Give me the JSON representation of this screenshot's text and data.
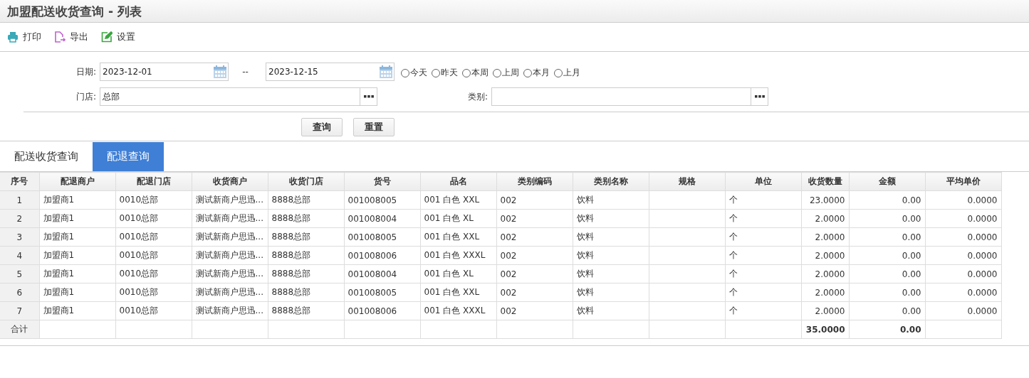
{
  "window": {
    "title": "加盟配送收货查询 - 列表"
  },
  "toolbar": [
    {
      "label": "打印"
    },
    {
      "label": "导出"
    },
    {
      "label": "设置"
    }
  ],
  "filters": {
    "date": {
      "label": "日期:",
      "from": "2023-12-01",
      "separator": "--",
      "to": "2023-12-15"
    },
    "quick_ranges": [
      {
        "label": "今天",
        "selected": false
      },
      {
        "label": "昨天",
        "selected": false
      },
      {
        "label": "本周",
        "selected": false
      },
      {
        "label": "上周",
        "selected": false
      },
      {
        "label": "本月",
        "selected": false
      },
      {
        "label": "上月",
        "selected": false
      }
    ],
    "store": {
      "label": "门店:",
      "value": "总部"
    },
    "category": {
      "label": "类别:"
    }
  },
  "buttons": [
    "查询",
    "重置"
  ],
  "tabs": [
    {
      "label": "配送收货查询",
      "selected": false
    },
    {
      "label": "配退查询",
      "selected": true
    }
  ],
  "table": {
    "columns": [
      {
        "label": "序号",
        "kind": "index"
      },
      {
        "label": "配退商户",
        "kind": "text"
      },
      {
        "label": "配退门店",
        "kind": "text"
      },
      {
        "label": "收货商户",
        "kind": "text"
      },
      {
        "label": "收货门店",
        "kind": "text"
      },
      {
        "label": "货号",
        "kind": "text"
      },
      {
        "label": "品名",
        "kind": "text"
      },
      {
        "label": "类别编码",
        "kind": "text"
      },
      {
        "label": "类别名称",
        "kind": "text"
      },
      {
        "label": "规格",
        "kind": "text"
      },
      {
        "label": "单位",
        "kind": "text"
      },
      {
        "label": "收货数量",
        "kind": "number",
        "total": "35.0000"
      },
      {
        "label": "金额",
        "kind": "number",
        "total": "0.00"
      },
      {
        "label": "平均单价",
        "kind": "number"
      }
    ],
    "rows": [
      [
        "1",
        "加盟商1",
        "0010总部",
        "测试新商户思迅...",
        "8888总部",
        "001008005",
        "001 白色 XXL",
        "002",
        "饮料",
        "",
        "个",
        "23.0000",
        "0.00",
        "0.0000"
      ],
      [
        "2",
        "加盟商1",
        "0010总部",
        "测试新商户思迅...",
        "8888总部",
        "001008004",
        "001 白色 XL",
        "002",
        "饮料",
        "",
        "个",
        "2.0000",
        "0.00",
        "0.0000"
      ],
      [
        "3",
        "加盟商1",
        "0010总部",
        "测试新商户思迅...",
        "8888总部",
        "001008005",
        "001 白色 XXL",
        "002",
        "饮料",
        "",
        "个",
        "2.0000",
        "0.00",
        "0.0000"
      ],
      [
        "4",
        "加盟商1",
        "0010总部",
        "测试新商户思迅...",
        "8888总部",
        "001008006",
        "001 白色 XXXL",
        "002",
        "饮料",
        "",
        "个",
        "2.0000",
        "0.00",
        "0.0000"
      ],
      [
        "5",
        "加盟商1",
        "0010总部",
        "测试新商户思迅...",
        "8888总部",
        "001008004",
        "001 白色 XL",
        "002",
        "饮料",
        "",
        "个",
        "2.0000",
        "0.00",
        "0.0000"
      ],
      [
        "6",
        "加盟商1",
        "0010总部",
        "测试新商户思迅...",
        "8888总部",
        "001008005",
        "001 白色 XXL",
        "002",
        "饮料",
        "",
        "个",
        "2.0000",
        "0.00",
        "0.0000"
      ],
      [
        "7",
        "加盟商1",
        "0010总部",
        "测试新商户思迅...",
        "8888总部",
        "001008006",
        "001 白色 XXXL",
        "002",
        "饮料",
        "",
        "个",
        "2.0000",
        "0.00",
        "0.0000"
      ]
    ],
    "total_label": "合计"
  }
}
